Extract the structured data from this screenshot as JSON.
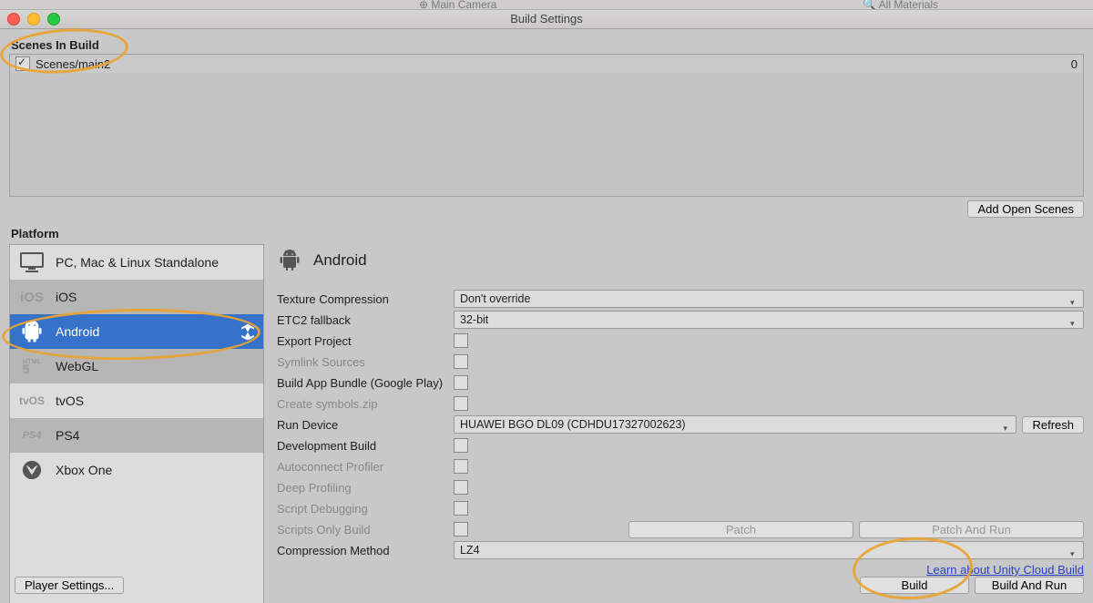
{
  "remnant": {
    "mid_icon": "⊕ Main Camera",
    "right": "🔍 All Materials"
  },
  "window_title": "Build Settings",
  "scenes_label": "Scenes In Build",
  "scenes": [
    {
      "checked": true,
      "name": "Scenes/main2",
      "index": "0"
    }
  ],
  "add_open_scenes": "Add Open Scenes",
  "platform_label": "Platform",
  "platforms": [
    {
      "id": "standalone",
      "label": "PC, Mac & Linux Standalone",
      "icon": "monitor",
      "selected": false
    },
    {
      "id": "ios",
      "label": "iOS",
      "icon": "ios",
      "selected": false
    },
    {
      "id": "android",
      "label": "Android",
      "icon": "android",
      "selected": true,
      "active": true
    },
    {
      "id": "webgl",
      "label": "WebGL",
      "icon": "html5",
      "selected": false
    },
    {
      "id": "tvos",
      "label": "tvOS",
      "icon": "tvos",
      "selected": false
    },
    {
      "id": "ps4",
      "label": "PS4",
      "icon": "ps4",
      "selected": false
    },
    {
      "id": "xboxone",
      "label": "Xbox One",
      "icon": "xbox",
      "selected": false
    }
  ],
  "detail_title": "Android",
  "form": {
    "texture_compression": {
      "label": "Texture Compression",
      "value": "Don't override"
    },
    "etc2_fallback": {
      "label": "ETC2 fallback",
      "value": "32-bit"
    },
    "export_project": {
      "label": "Export Project"
    },
    "symlink_sources": {
      "label": "Symlink Sources"
    },
    "build_app_bundle": {
      "label": "Build App Bundle (Google Play)"
    },
    "create_symbols": {
      "label": "Create symbols.zip"
    },
    "run_device": {
      "label": "Run Device",
      "value": "HUAWEI BGO DL09 (CDHDU17327002623)",
      "refresh": "Refresh"
    },
    "development_build": {
      "label": "Development Build"
    },
    "autoconnect_profiler": {
      "label": "Autoconnect Profiler"
    },
    "deep_profiling": {
      "label": "Deep Profiling"
    },
    "script_debugging": {
      "label": "Script Debugging"
    },
    "scripts_only_build": {
      "label": "Scripts Only Build"
    },
    "patch": {
      "patch": "Patch",
      "patch_run": "Patch And Run"
    },
    "compression_method": {
      "label": "Compression Method",
      "value": "LZ4"
    }
  },
  "cloud_link": "Learn about Unity Cloud Build",
  "player_settings": "Player Settings...",
  "build_btn": "Build",
  "build_run_btn": "Build And Run"
}
